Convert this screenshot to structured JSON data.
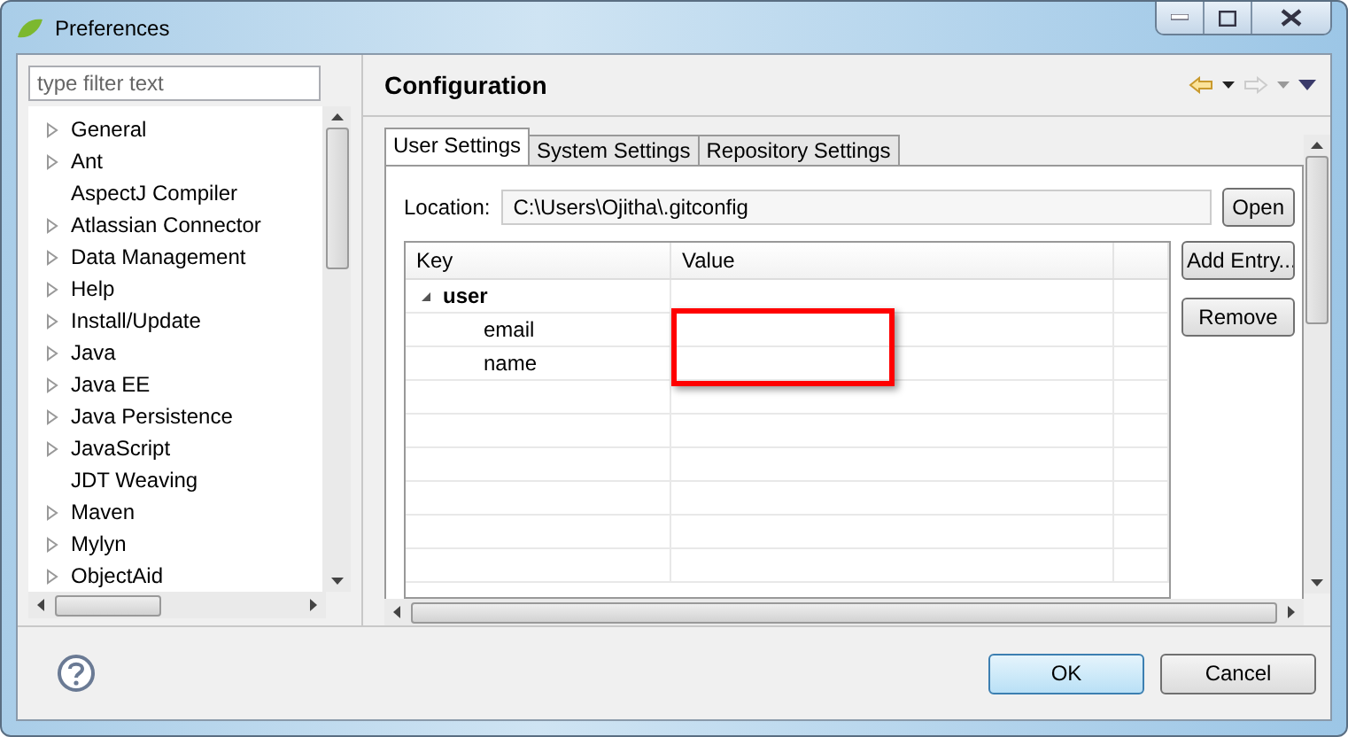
{
  "window": {
    "title": "Preferences"
  },
  "sidebar": {
    "filter": {
      "placeholder": "type filter text"
    },
    "items": [
      {
        "label": "General",
        "expandable": true
      },
      {
        "label": "Ant",
        "expandable": true
      },
      {
        "label": "AspectJ Compiler",
        "expandable": false
      },
      {
        "label": "Atlassian Connector",
        "expandable": true
      },
      {
        "label": "Data Management",
        "expandable": true
      },
      {
        "label": "Help",
        "expandable": true
      },
      {
        "label": "Install/Update",
        "expandable": true
      },
      {
        "label": "Java",
        "expandable": true
      },
      {
        "label": "Java EE",
        "expandable": true
      },
      {
        "label": "Java Persistence",
        "expandable": true
      },
      {
        "label": "JavaScript",
        "expandable": true
      },
      {
        "label": "JDT Weaving",
        "expandable": false
      },
      {
        "label": "Maven",
        "expandable": true
      },
      {
        "label": "Mylyn",
        "expandable": true
      },
      {
        "label": "ObjectAid",
        "expandable": true
      }
    ]
  },
  "page": {
    "title": "Configuration",
    "tabs": [
      {
        "label": "User Settings",
        "selected": true
      },
      {
        "label": "System Settings",
        "selected": false
      },
      {
        "label": "Repository Settings",
        "selected": false
      }
    ],
    "location": {
      "label": "Location:",
      "value": "C:\\Users\\Ojitha\\.gitconfig",
      "button": "Open"
    },
    "table": {
      "columns": [
        "Key",
        "Value"
      ],
      "rows": [
        {
          "key": "user",
          "expanded": true,
          "children": [
            {
              "key": "email"
            },
            {
              "key": "name"
            }
          ]
        }
      ]
    },
    "buttons": [
      "Add Entry...",
      "Remove"
    ]
  },
  "footer": {
    "buttons": [
      {
        "label": "OK",
        "default": true
      },
      {
        "label": "Cancel",
        "default": false
      }
    ]
  }
}
